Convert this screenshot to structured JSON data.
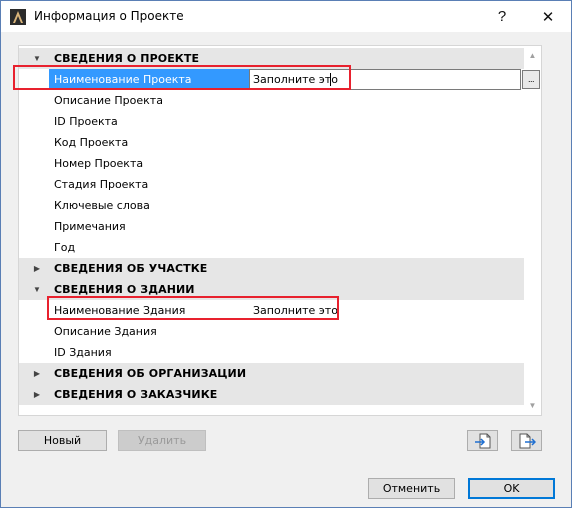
{
  "window": {
    "title": "Информация о Проекте",
    "help_glyph": "?",
    "close_glyph": "✕"
  },
  "groups": [
    {
      "label": "СВЕДЕНИЯ О ПРОЕКТЕ",
      "expanded": true,
      "properties": [
        {
          "label": "Наименование Проекта",
          "value": "Заполните это",
          "selected": true
        },
        {
          "label": "Описание Проекта",
          "value": ""
        },
        {
          "label": "ID Проекта",
          "value": ""
        },
        {
          "label": "Код Проекта",
          "value": ""
        },
        {
          "label": "Номер Проекта",
          "value": ""
        },
        {
          "label": "Стадия Проекта",
          "value": ""
        },
        {
          "label": "Ключевые слова",
          "value": ""
        },
        {
          "label": "Примечания",
          "value": ""
        },
        {
          "label": "Год",
          "value": ""
        }
      ]
    },
    {
      "label": "СВЕДЕНИЯ ОБ УЧАСТКЕ",
      "expanded": false
    },
    {
      "label": "СВЕДЕНИЯ О ЗДАНИИ",
      "expanded": true,
      "properties": [
        {
          "label": "Наименование Здания",
          "value": "Заполните это"
        },
        {
          "label": "Описание Здания",
          "value": ""
        },
        {
          "label": "ID Здания",
          "value": ""
        }
      ]
    },
    {
      "label": "СВЕДЕНИЯ ОБ ОРГАНИЗАЦИИ",
      "expanded": false
    },
    {
      "label": "СВЕДЕНИЯ О ЗАКАЗЧИКЕ",
      "expanded": false
    }
  ],
  "ellipsis_label": "...",
  "buttons": {
    "new": "Новый",
    "delete": "Удалить",
    "cancel": "Отменить",
    "ok": "OK"
  },
  "icons": {
    "import": "import-file-icon",
    "export": "export-file-icon"
  },
  "colors": {
    "selection": "#3399ff",
    "highlight_box": "#e8212e",
    "group_bg": "#e6e6e6",
    "default_button_border": "#0078d7"
  }
}
